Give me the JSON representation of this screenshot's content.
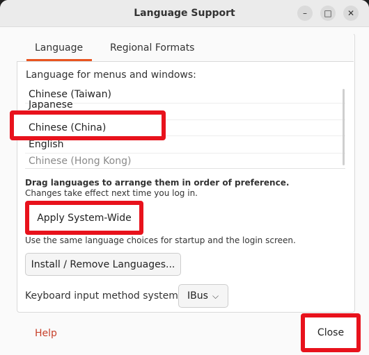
{
  "window": {
    "title": "Language Support",
    "controls": {
      "minimize": "–",
      "maximize": "□",
      "close": "✕"
    }
  },
  "tabs": [
    {
      "label": "Language",
      "active": true
    },
    {
      "label": "Regional Formats",
      "active": false
    }
  ],
  "language_section": {
    "label": "Language for menus and windows:",
    "languages": [
      {
        "name": "Chinese (Taiwan)",
        "enabled": true
      },
      {
        "name": "Japanese",
        "enabled": true
      },
      {
        "name": "Chinese (China)",
        "enabled": true
      },
      {
        "name": "English",
        "enabled": true
      },
      {
        "name": "Chinese (Hong Kong)",
        "enabled": false
      }
    ],
    "hint_bold": "Drag languages to arrange them in order of preference.",
    "hint": "Changes take effect next time you log in."
  },
  "apply_button": {
    "label": "Apply System-Wide"
  },
  "apply_hint": "Use the same language choices for startup and the login screen.",
  "install_button": {
    "label": "Install / Remove Languages..."
  },
  "keyboard": {
    "label": "Keyboard input method system:",
    "selected": "IBus",
    "chevron": "⌵"
  },
  "footer": {
    "help_label": "Help",
    "close_label": "Close"
  },
  "colors": {
    "accent": "#e95420",
    "highlight": "#e8121c",
    "help": "#c7402a"
  }
}
